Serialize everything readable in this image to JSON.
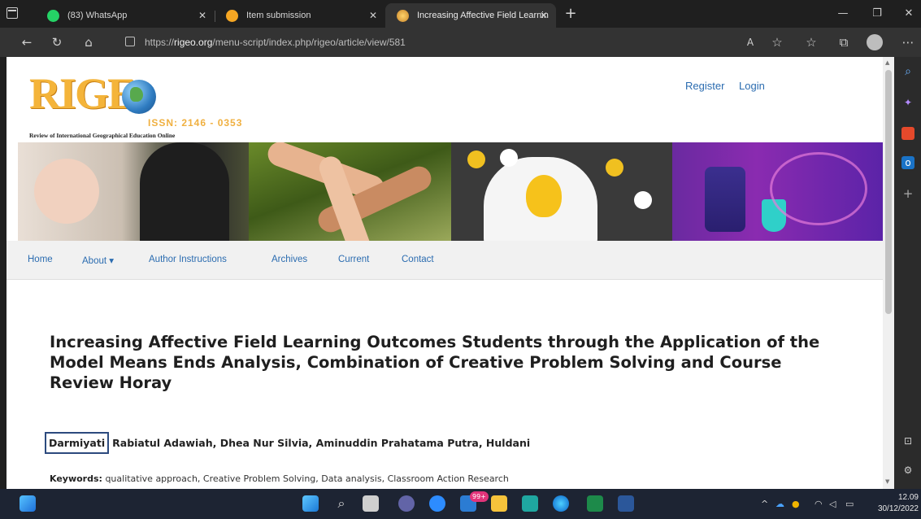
{
  "browser": {
    "tabs": [
      {
        "title": "(83) WhatsApp",
        "active": false,
        "icon": "whatsapp-icon"
      },
      {
        "title": "Item submission",
        "active": false,
        "icon": "smiley-icon"
      },
      {
        "title": "Increasing Affective Field Learnin",
        "active": true,
        "icon": "rigeo-globe-icon"
      }
    ],
    "url_prefix": "https://",
    "url_domain": "rigeo.org",
    "url_path": "/menu-script/index.php/rigeo/article/view/581"
  },
  "site": {
    "logo_text": "RIGE",
    "issn": "ISSN: 2146 - 0353",
    "logo_subtitle": "Review of International Geographical Education Online",
    "register": "Register",
    "login": "Login",
    "nav": {
      "home": "Home",
      "about": "About ▾",
      "author_instructions": "Author Instructions",
      "archives": "Archives",
      "current": "Current",
      "contact": "Contact"
    }
  },
  "article": {
    "title": "Increasing Affective Field Learning Outcomes Students through the Application of the Model Means Ends Analysis, Combination of Creative Problem Solving and Course Review Horay",
    "first_author": "Darmiyati",
    "other_authors": "Rabiatul Adawiah, Dhea Nur Silvia, Aminuddin Prahatama Putra, Huldani",
    "keywords_label": "Keywords:",
    "keywords": "qualitative approach, Creative Problem Solving, Data analysis, Classroom Action Research"
  },
  "taskbar": {
    "badge": "99+",
    "time": "12.09",
    "date": "30/12/2022"
  }
}
